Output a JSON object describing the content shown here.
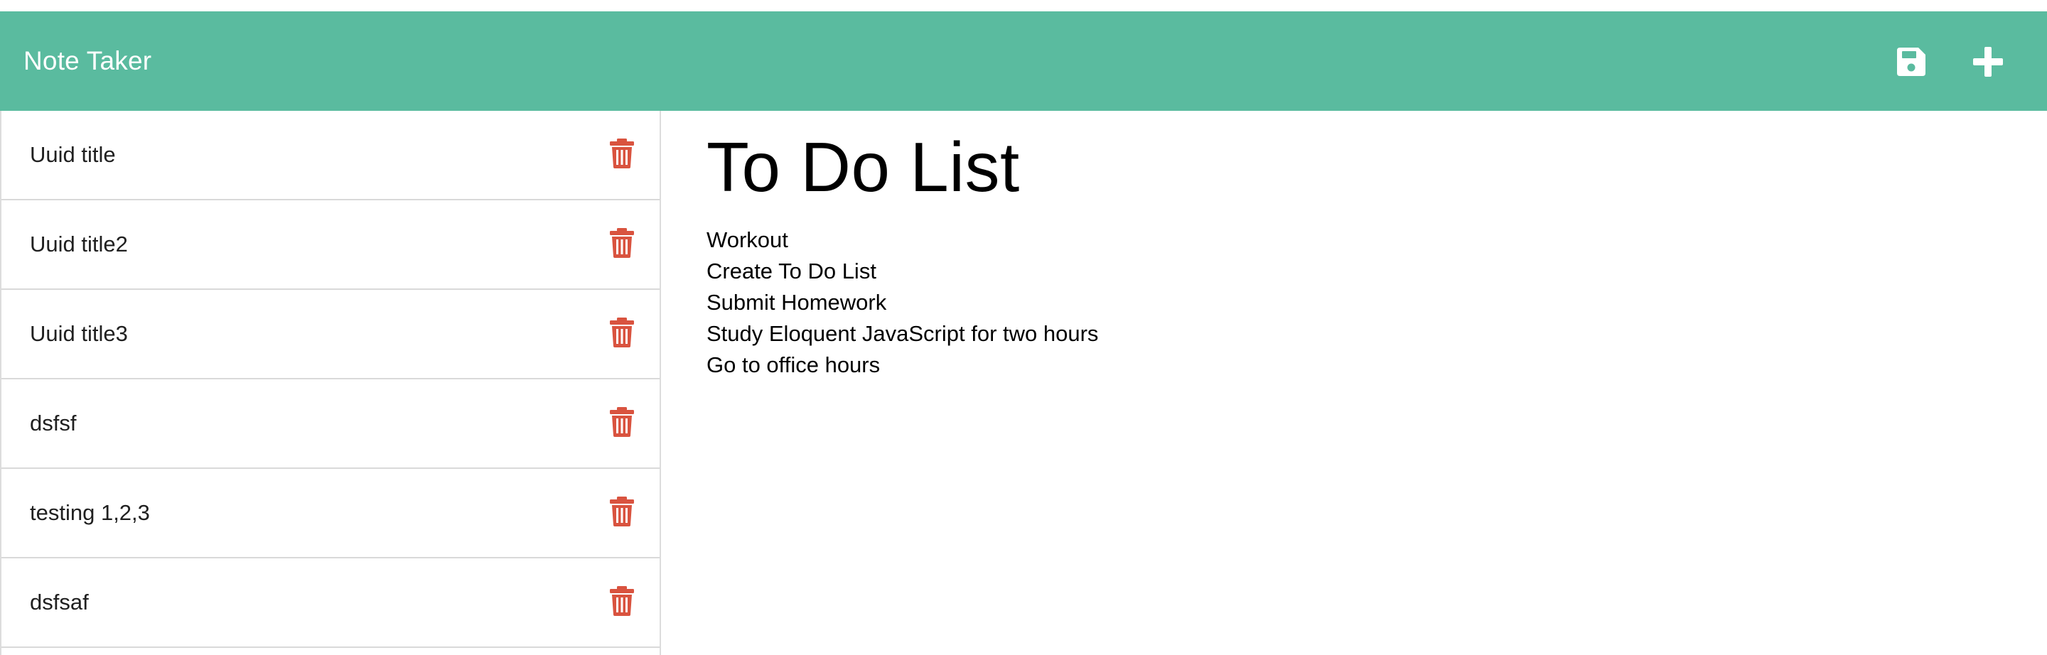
{
  "navbar": {
    "brand": "Note Taker",
    "background": "#5abb9f",
    "icons": {
      "save": "save-icon",
      "new_note": "plus-icon"
    }
  },
  "sidebar": {
    "delete_icon": "trash-icon",
    "delete_color": "#d9533f",
    "notes": [
      {
        "title": "Uuid title"
      },
      {
        "title": "Uuid title2"
      },
      {
        "title": "Uuid title3"
      },
      {
        "title": "dsfsf"
      },
      {
        "title": "testing 1,2,3"
      },
      {
        "title": "dsfsaf"
      }
    ]
  },
  "editor": {
    "title": "To Do List",
    "lines": [
      "Workout",
      "Create To Do List",
      "Submit Homework",
      "Study Eloquent JavaScript for two hours",
      "Go to office hours"
    ]
  }
}
